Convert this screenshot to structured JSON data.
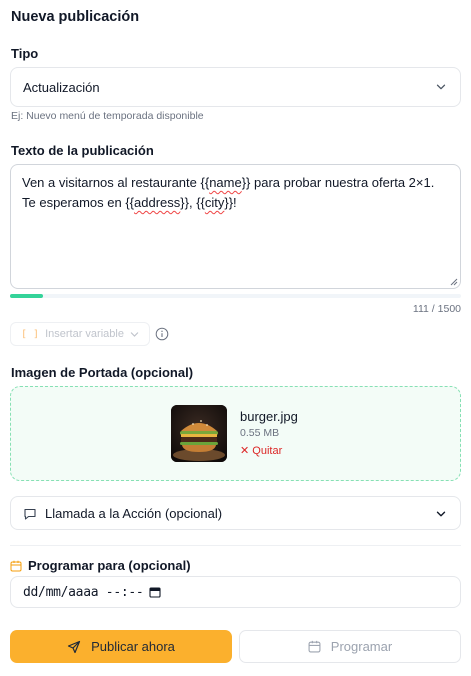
{
  "title": "Nueva publicación",
  "type_field": {
    "label": "Tipo",
    "selected": "Actualización",
    "hint": "Ej: Nuevo menú de temporada disponible"
  },
  "text_field": {
    "label": "Texto de la publicación",
    "line1_a": "Ven a visitarnos al restaurante {{",
    "line1_var": "name",
    "line1_b": "}} para probar nuestra oferta 2×1.",
    "line2_a": "Te esperamos en {{",
    "line2_var1": "address",
    "line2_b": "}}, {{",
    "line2_var2": "city",
    "line2_c": "}}!",
    "char_count": "111 / 1500",
    "progress_fraction": 0.074
  },
  "variable_button": {
    "bracket": "[ ]",
    "label": "Insertar variable"
  },
  "cover_image": {
    "label": "Imagen de Portada (opcional)",
    "file_name": "burger.jpg",
    "file_size": "0.55 MB",
    "remove_label": "Quitar"
  },
  "cta": {
    "label": "Llamada a la Acción (opcional)"
  },
  "schedule": {
    "label": "Programar para (opcional)",
    "placeholder": "dd/mm/aaaa --:--"
  },
  "actions": {
    "publish_label": "Publicar ahora",
    "schedule_label": "Programar"
  },
  "colors": {
    "accent": "#fbb02d",
    "progress": "#34d399",
    "danger": "#dc2626",
    "dropzone_border": "#86e0b4"
  },
  "icons": [
    "chevron-down-icon",
    "info-icon",
    "close-icon",
    "message-icon",
    "calendar-icon",
    "send-icon"
  ]
}
